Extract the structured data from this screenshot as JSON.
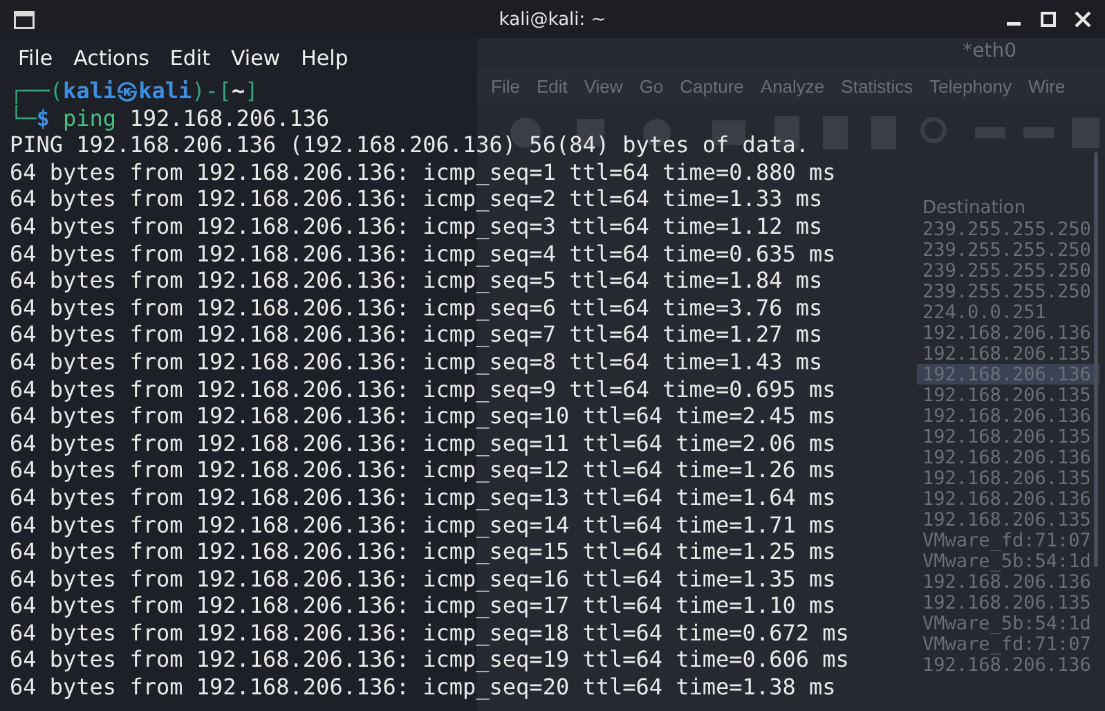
{
  "window": {
    "title": "kali@kali: ~"
  },
  "menu": [
    "File",
    "Actions",
    "Edit",
    "View",
    "Help"
  ],
  "prompt_line": [
    {
      "text": "┌──(",
      "kind": "frame"
    },
    {
      "text": "kali㉿kali",
      "kind": "user"
    },
    {
      "text": ")-[",
      "kind": "frame"
    },
    {
      "text": "~",
      "kind": "dir"
    },
    {
      "text": "]",
      "kind": "frame"
    }
  ],
  "command_line": [
    {
      "text": "└─",
      "kind": "frame"
    },
    {
      "text": "$",
      "kind": "symbol"
    },
    {
      "text": "ping",
      "kind": "command"
    },
    {
      "text": "192.168.206.136",
      "kind": "arg"
    }
  ],
  "output": [
    "PING 192.168.206.136 (192.168.206.136) 56(84) bytes of data.",
    "64 bytes from 192.168.206.136: icmp_seq=1 ttl=64 time=0.880 ms",
    "64 bytes from 192.168.206.136: icmp_seq=2 ttl=64 time=1.33 ms",
    "64 bytes from 192.168.206.136: icmp_seq=3 ttl=64 time=1.12 ms",
    "64 bytes from 192.168.206.136: icmp_seq=4 ttl=64 time=0.635 ms",
    "64 bytes from 192.168.206.136: icmp_seq=5 ttl=64 time=1.84 ms",
    "64 bytes from 192.168.206.136: icmp_seq=6 ttl=64 time=3.76 ms",
    "64 bytes from 192.168.206.136: icmp_seq=7 ttl=64 time=1.27 ms",
    "64 bytes from 192.168.206.136: icmp_seq=8 ttl=64 time=1.43 ms",
    "64 bytes from 192.168.206.136: icmp_seq=9 ttl=64 time=0.695 ms",
    "64 bytes from 192.168.206.136: icmp_seq=10 ttl=64 time=2.45 ms",
    "64 bytes from 192.168.206.136: icmp_seq=11 ttl=64 time=2.06 ms",
    "64 bytes from 192.168.206.136: icmp_seq=12 ttl=64 time=1.26 ms",
    "64 bytes from 192.168.206.136: icmp_seq=13 ttl=64 time=1.64 ms",
    "64 bytes from 192.168.206.136: icmp_seq=14 ttl=64 time=1.71 ms",
    "64 bytes from 192.168.206.136: icmp_seq=15 ttl=64 time=1.25 ms",
    "64 bytes from 192.168.206.136: icmp_seq=16 ttl=64 time=1.35 ms",
    "64 bytes from 192.168.206.136: icmp_seq=17 ttl=64 time=1.10 ms",
    "64 bytes from 192.168.206.136: icmp_seq=18 ttl=64 time=0.672 ms",
    "64 bytes from 192.168.206.136: icmp_seq=19 ttl=64 time=0.606 ms",
    "64 bytes from 192.168.206.136: icmp_seq=20 ttl=64 time=1.38 ms"
  ],
  "background_window": {
    "title": "*eth0",
    "menu": [
      "File",
      "Edit",
      "View",
      "Go",
      "Capture",
      "Analyze",
      "Statistics",
      "Telephony",
      "Wire"
    ],
    "column_header": "Destination",
    "rows": [
      {
        "text": "239.255.255.250",
        "selected": false
      },
      {
        "text": "239.255.255.250",
        "selected": false
      },
      {
        "text": "239.255.255.250",
        "selected": false
      },
      {
        "text": "239.255.255.250",
        "selected": false
      },
      {
        "text": "224.0.0.251",
        "selected": false
      },
      {
        "text": "192.168.206.136",
        "selected": false
      },
      {
        "text": "192.168.206.135",
        "selected": false
      },
      {
        "text": "192.168.206.136",
        "selected": true
      },
      {
        "text": "192.168.206.135",
        "selected": false
      },
      {
        "text": "192.168.206.136",
        "selected": false
      },
      {
        "text": "192.168.206.135",
        "selected": false
      },
      {
        "text": "192.168.206.136",
        "selected": false
      },
      {
        "text": "192.168.206.135",
        "selected": false
      },
      {
        "text": "192.168.206.136",
        "selected": false
      },
      {
        "text": "192.168.206.135",
        "selected": false
      },
      {
        "text": "VMware_fd:71:07",
        "selected": false
      },
      {
        "text": "VMware_5b:54:1d",
        "selected": false
      },
      {
        "text": "192.168.206.136",
        "selected": false
      },
      {
        "text": "192.168.206.135",
        "selected": false
      },
      {
        "text": "VMware_5b:54:1d",
        "selected": false
      },
      {
        "text": "VMware_fd:71:07",
        "selected": false
      },
      {
        "text": "192.168.206.136",
        "selected": false
      }
    ]
  }
}
